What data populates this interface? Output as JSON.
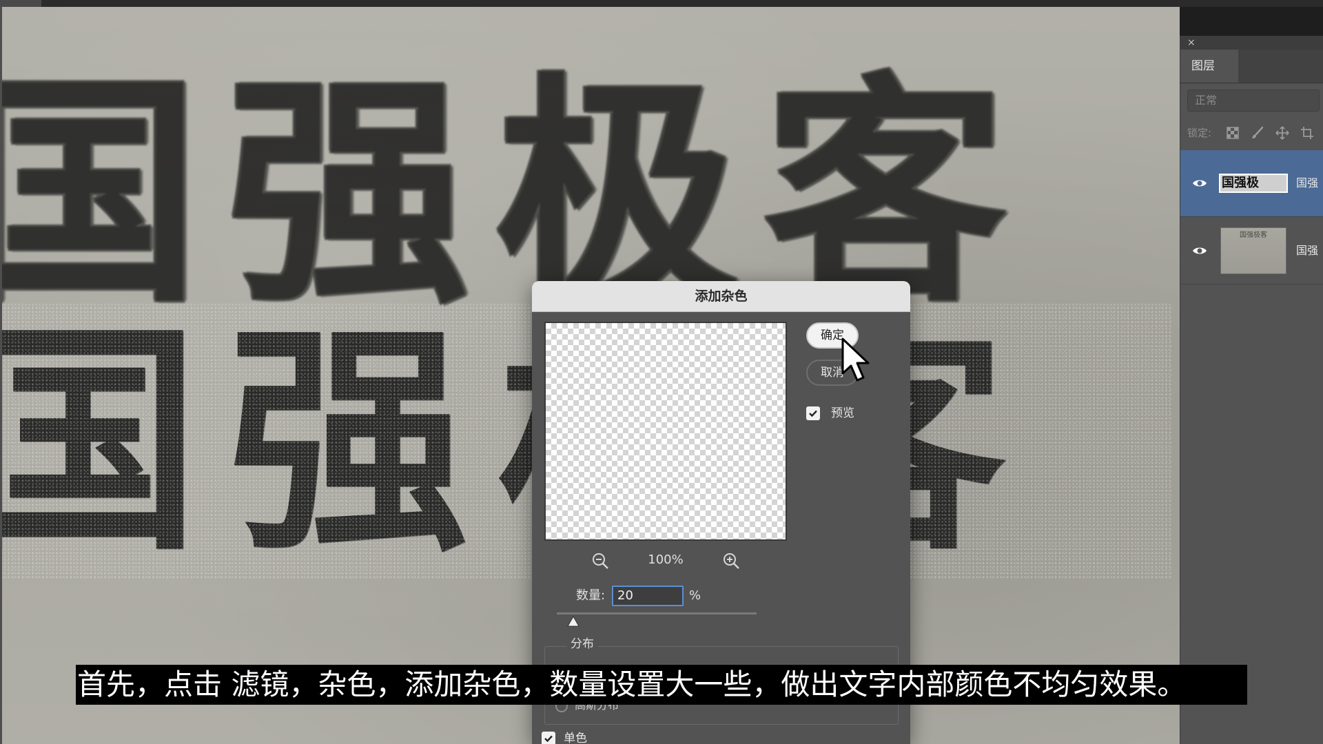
{
  "canvas": {
    "row1_text": "国强极客",
    "row2_text": "国强极客"
  },
  "layers_panel": {
    "close_glyph": "×",
    "tab_label": "图层",
    "blend_mode": "正常",
    "lock_label": "锁定:",
    "layers": [
      {
        "thumb_text": "国强极",
        "name": "国强"
      },
      {
        "thumb_text": "国强极客",
        "name": "国强"
      }
    ]
  },
  "dialog": {
    "title": "添加杂色",
    "ok_label": "确定",
    "cancel_label": "取消",
    "preview_label": "预览",
    "preview_checked": true,
    "zoom_value": "100%",
    "amount_label": "数量:",
    "amount_value": "20",
    "amount_unit": "%",
    "amount_fraction": 0.05,
    "distribution_label": "分布",
    "distribution_option_partial": "高斯分布",
    "mono_label": "单色",
    "mono_checked": true
  },
  "subtitle": {
    "text": "首先，点击 滤镜，杂色，添加杂色，数量设置大一些，做出文字内部颜色不均匀效果。"
  },
  "colors": {
    "panel_bg": "#535353",
    "selected_layer": "#4b6a96",
    "input_focus": "#5b8fd6",
    "canvas_paper": "#afaea6",
    "ink": "#262625"
  },
  "icons": [
    "close-icon",
    "eye-icon",
    "lock-transparent-icon",
    "lock-brush-icon",
    "lock-move-icon",
    "lock-artboard-icon",
    "zoom-out-icon",
    "zoom-in-icon",
    "checkbox-check-icon",
    "slider-thumb-icon",
    "mouse-pointer-icon"
  ]
}
